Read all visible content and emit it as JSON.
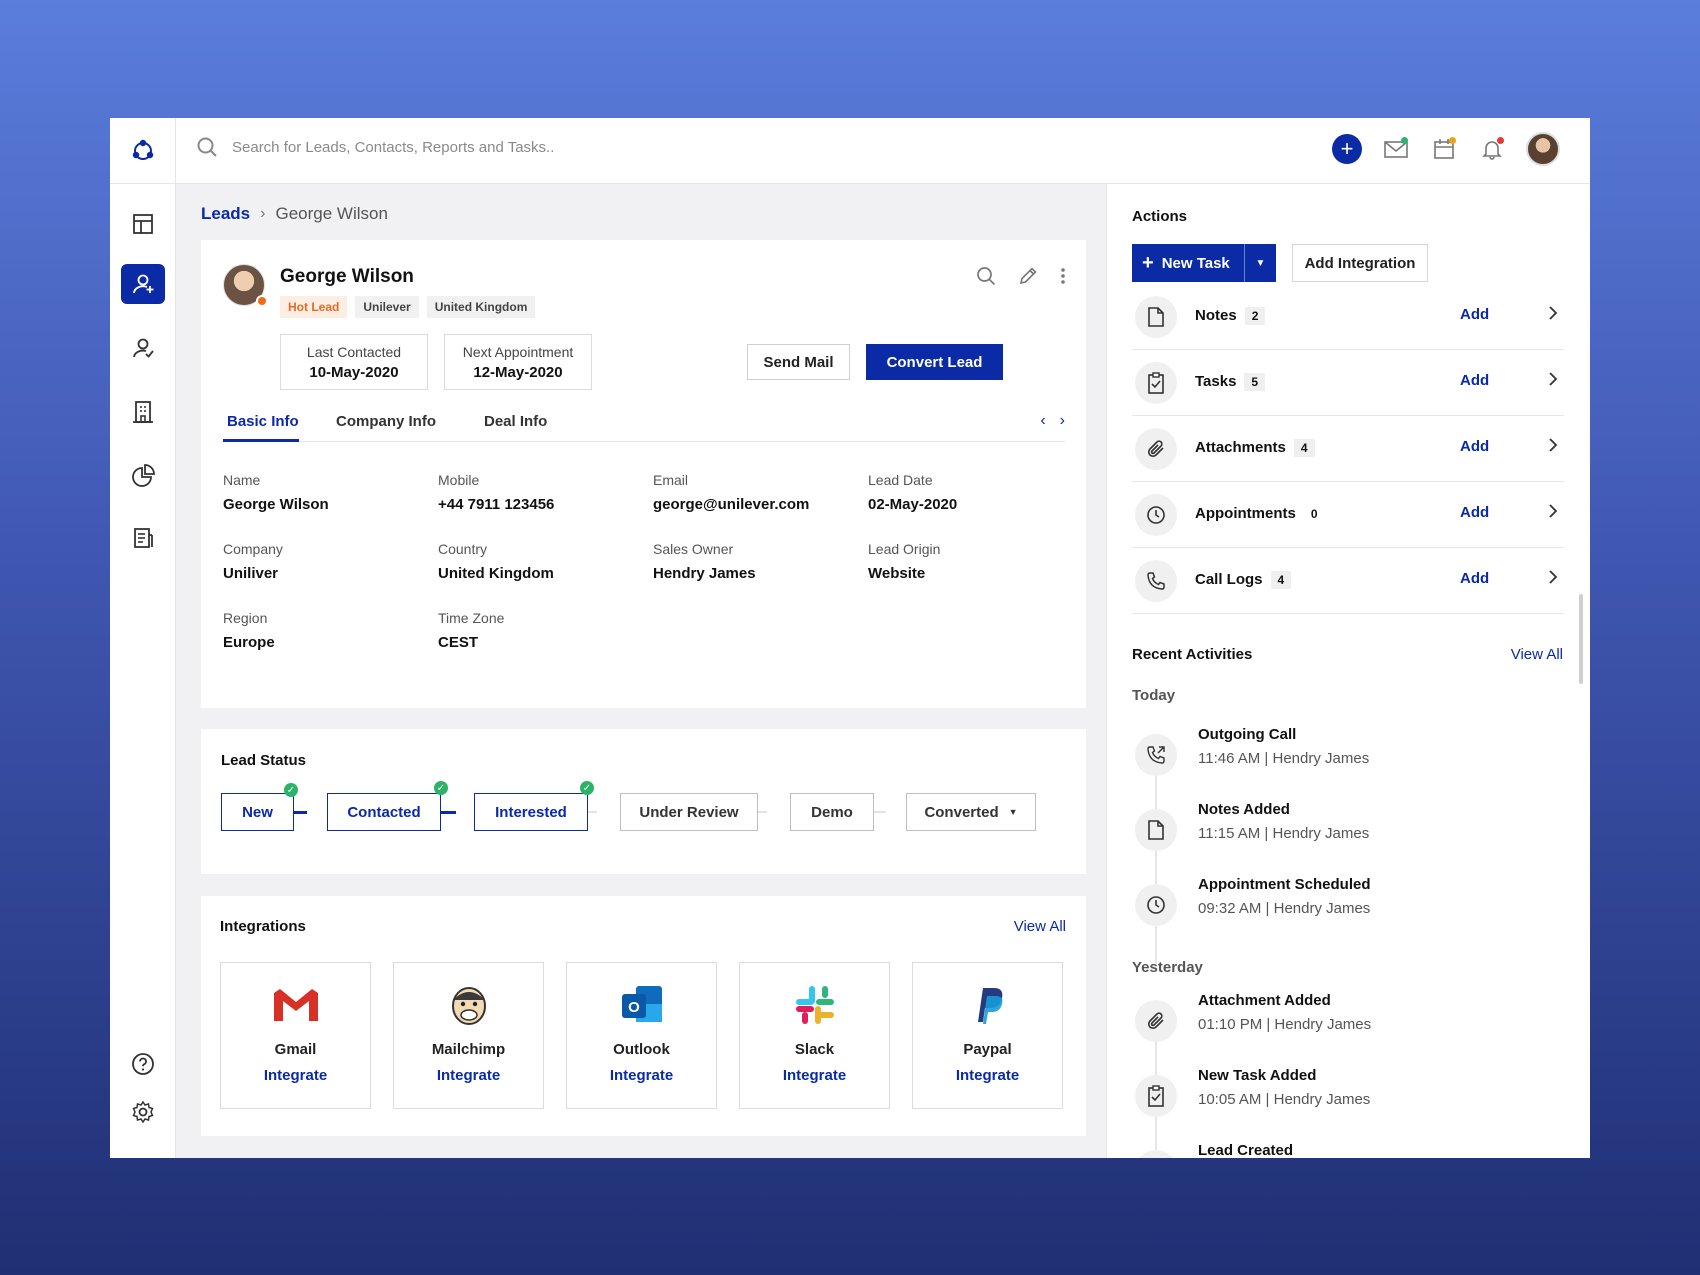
{
  "search": {
    "placeholder": "Search for Leads, Contacts, Reports and Tasks.."
  },
  "header": {
    "avatar_alt": "User avatar"
  },
  "breadcrumb": {
    "root": "Leads",
    "current": "George Wilson"
  },
  "profile": {
    "name": "George Wilson",
    "tags": [
      "Hot Lead",
      "Unilever",
      "United Kingdom"
    ],
    "last_contacted_label": "Last Contacted",
    "last_contacted": "10-May-2020",
    "next_appointment_label": "Next Appointment",
    "next_appointment": "12-May-2020",
    "send_mail": "Send Mail",
    "convert_lead": "Convert Lead",
    "tabs": [
      "Basic Info",
      "Company Info",
      "Deal Info"
    ],
    "fields": [
      {
        "label": "Name",
        "value": "George Wilson"
      },
      {
        "label": "Mobile",
        "value": "+44 7911 123456"
      },
      {
        "label": "Email",
        "value": "george@unilever.com"
      },
      {
        "label": "Lead Date",
        "value": "02-May-2020"
      },
      {
        "label": "Company",
        "value": "Uniliver"
      },
      {
        "label": "Country",
        "value": "United Kingdom"
      },
      {
        "label": "Sales Owner",
        "value": "Hendry James"
      },
      {
        "label": "Lead Origin",
        "value": "Website"
      },
      {
        "label": "Region",
        "value": "Europe"
      },
      {
        "label": "Time Zone",
        "value": "CEST"
      }
    ]
  },
  "lead_status": {
    "title": "Lead Status",
    "stages": [
      "New",
      "Contacted",
      "Interested",
      "Under Review",
      "Demo",
      "Converted"
    ]
  },
  "integrations": {
    "title": "Integrations",
    "view_all": "View All",
    "items": [
      {
        "name": "Gmail",
        "action": "Integrate"
      },
      {
        "name": "Mailchimp",
        "action": "Integrate"
      },
      {
        "name": "Outlook",
        "action": "Integrate"
      },
      {
        "name": "Slack",
        "action": "Integrate"
      },
      {
        "name": "Paypal",
        "action": "Integrate"
      }
    ]
  },
  "actions": {
    "title": "Actions",
    "new_task": "New Task",
    "add_integration": "Add Integration",
    "rows": [
      {
        "label": "Notes",
        "count": "2",
        "add": "Add",
        "icon": "file-icon"
      },
      {
        "label": "Tasks",
        "count": "5",
        "add": "Add",
        "icon": "clipboard-check-icon"
      },
      {
        "label": "Attachments",
        "count": "4",
        "add": "Add",
        "icon": "paperclip-icon"
      },
      {
        "label": "Appointments",
        "count": "0",
        "add": "Add",
        "icon": "clock-icon"
      },
      {
        "label": "Call Logs",
        "count": "4",
        "add": "Add",
        "icon": "phone-icon"
      }
    ]
  },
  "recent": {
    "title": "Recent Activities",
    "view_all": "View All",
    "today": "Today",
    "yesterday": "Yesterday",
    "items": [
      {
        "title": "Outgoing Call",
        "sub": "11:46 AM | Hendry James"
      },
      {
        "title": "Notes Added",
        "sub": "11:15 AM | Hendry James"
      },
      {
        "title": "Appointment Scheduled",
        "sub": "09:32 AM | Hendry James"
      },
      {
        "title": "Attachment Added",
        "sub": "01:10 PM | Hendry James"
      },
      {
        "title": "New Task Added",
        "sub": "10:05 AM | Hendry James"
      },
      {
        "title": "Lead Created",
        "sub": ""
      }
    ]
  },
  "colors": {
    "primary": "#0b2aa6",
    "hot_lead": "#e46a24",
    "success": "#2cb36a"
  }
}
